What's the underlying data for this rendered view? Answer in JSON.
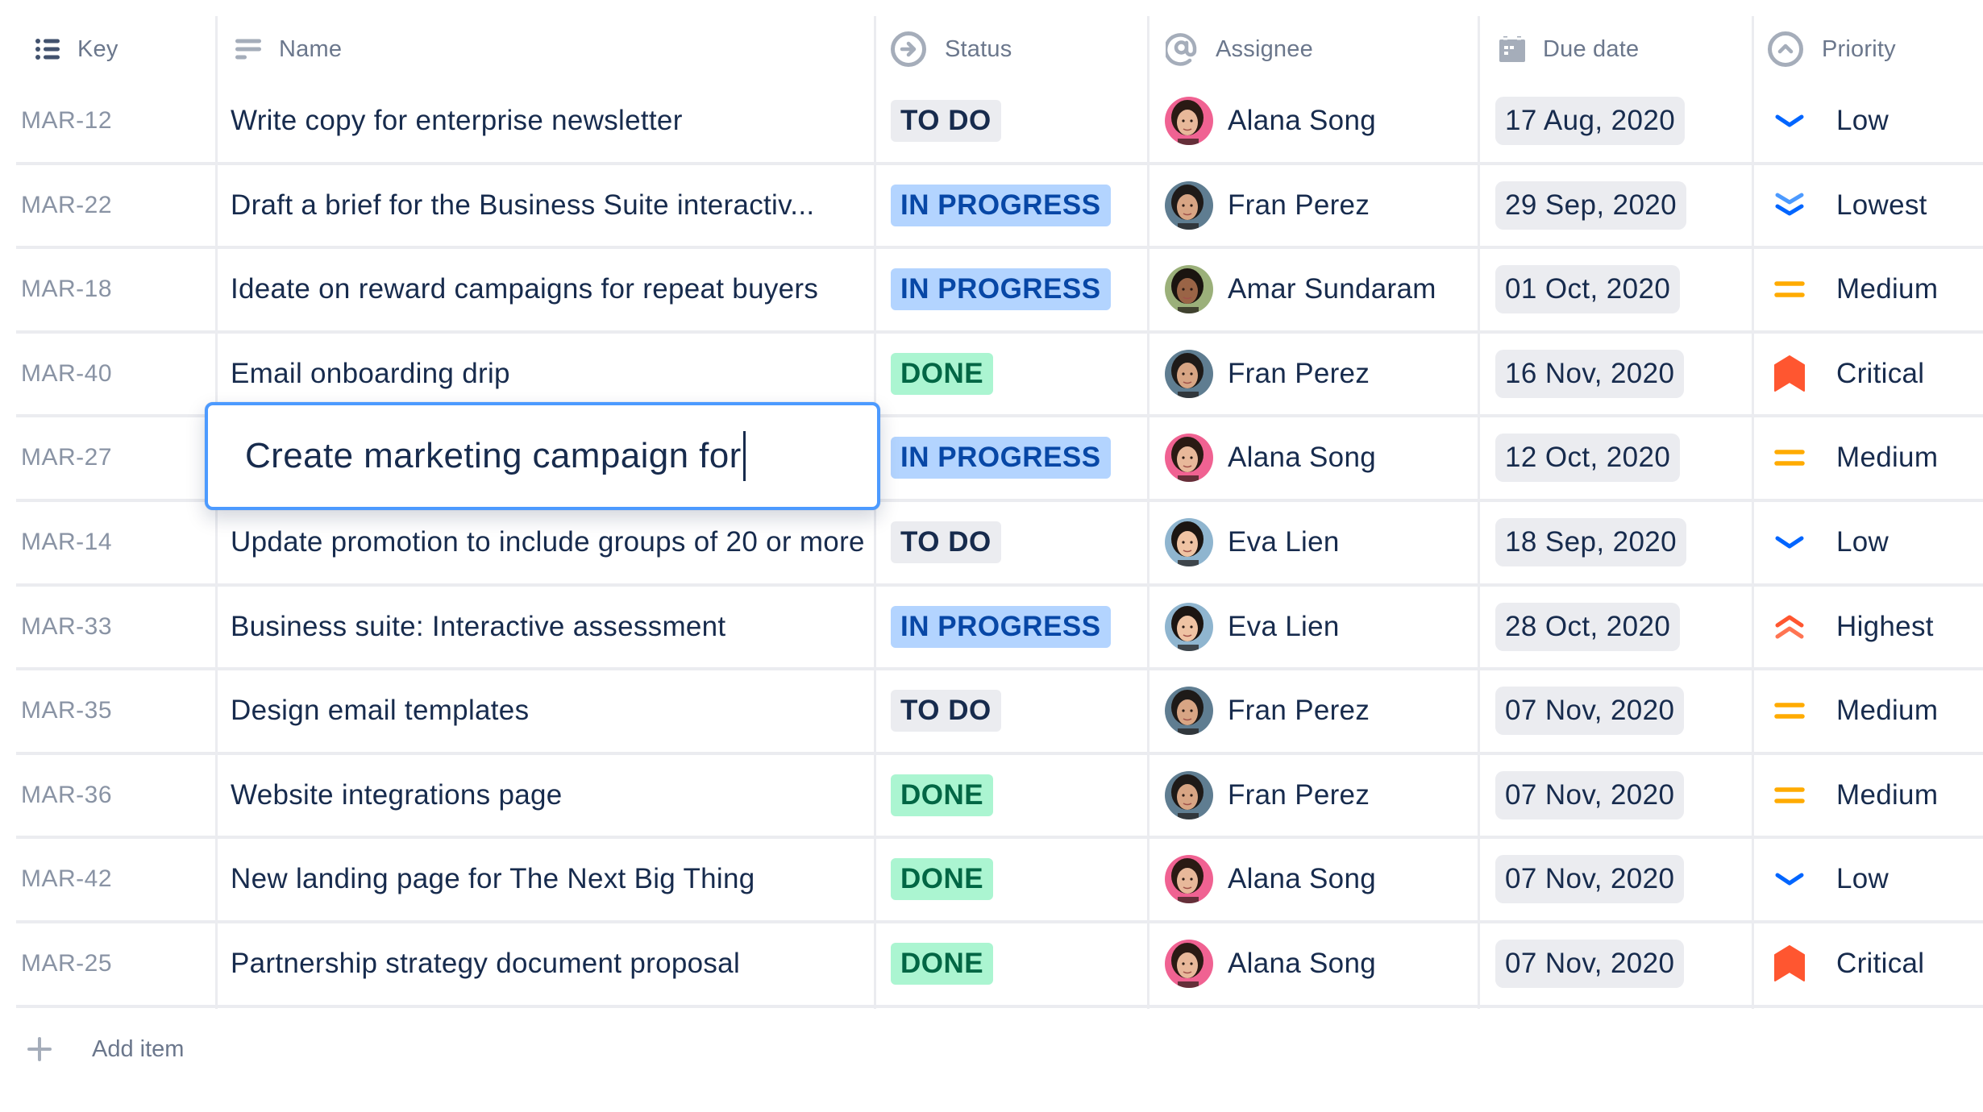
{
  "columns": {
    "key": {
      "label": "Key",
      "icon": "list-bullet-icon"
    },
    "name": {
      "label": "Name",
      "icon": "text-lines-icon"
    },
    "status": {
      "label": "Status",
      "icon": "arrow-circle-right-icon"
    },
    "assignee": {
      "label": "Assignee",
      "icon": "at-sign-icon"
    },
    "due_date": {
      "label": "Due date",
      "icon": "calendar-icon"
    },
    "priority": {
      "label": "Priority",
      "icon": "chevron-circle-up-icon"
    }
  },
  "status_colors": {
    "TO DO": {
      "bg": "#ebecf0",
      "fg": "#172b4d"
    },
    "IN PROGRESS": {
      "bg": "#b3d4ff",
      "fg": "#0747a6"
    },
    "DONE": {
      "bg": "#abf5d1",
      "fg": "#006644"
    }
  },
  "priority_colors": {
    "Lowest": "#0065ff",
    "Low": "#0065ff",
    "Medium": "#ffab00",
    "Highest": "#ff5630",
    "Critical": "#ff5630"
  },
  "rows": [
    {
      "key": "MAR-12",
      "name": "Write copy for enterprise newsletter",
      "status": "TO DO",
      "assignee": "Alana Song",
      "due_date": "17 Aug, 2020",
      "priority": "Low"
    },
    {
      "key": "MAR-22",
      "name": "Draft a brief for the Business Suite interactiv...",
      "status": "IN PROGRESS",
      "assignee": "Fran Perez",
      "due_date": "29 Sep, 2020",
      "priority": "Lowest"
    },
    {
      "key": "MAR-18",
      "name": "Ideate on reward campaigns for repeat buyers",
      "status": "IN PROGRESS",
      "assignee": "Amar Sundaram",
      "due_date": "01 Oct, 2020",
      "priority": "Medium"
    },
    {
      "key": "MAR-40",
      "name": "Email onboarding drip",
      "status": "DONE",
      "assignee": "Fran Perez",
      "due_date": "16 Nov, 2020",
      "priority": "Critical"
    },
    {
      "key": "MAR-27",
      "name": "",
      "status": "IN PROGRESS",
      "assignee": "Alana Song",
      "due_date": "12 Oct, 2020",
      "priority": "Medium"
    },
    {
      "key": "MAR-14",
      "name": "Update promotion to include groups of 20 or more",
      "status": "TO DO",
      "assignee": "Eva Lien",
      "due_date": "18 Sep, 2020",
      "priority": "Low"
    },
    {
      "key": "MAR-33",
      "name": "Business suite: Interactive assessment",
      "status": "IN PROGRESS",
      "assignee": "Eva Lien",
      "due_date": "28 Oct, 2020",
      "priority": "Highest"
    },
    {
      "key": "MAR-35",
      "name": "Design email templates",
      "status": "TO DO",
      "assignee": "Fran Perez",
      "due_date": "07 Nov, 2020",
      "priority": "Medium"
    },
    {
      "key": "MAR-36",
      "name": "Website integrations page",
      "status": "DONE",
      "assignee": "Fran Perez",
      "due_date": "07 Nov, 2020",
      "priority": "Medium"
    },
    {
      "key": "MAR-42",
      "name": "New landing page for The Next Big Thing",
      "status": "DONE",
      "assignee": "Alana Song",
      "due_date": "07 Nov, 2020",
      "priority": "Low"
    },
    {
      "key": "MAR-25",
      "name": "Partnership strategy document proposal",
      "status": "DONE",
      "assignee": "Alana Song",
      "due_date": "07 Nov, 2020",
      "priority": "Critical"
    }
  ],
  "editor": {
    "row_key": "MAR-27",
    "value": "Create marketing campaign for"
  },
  "avatars": {
    "Alana Song": {
      "skin": "#e8b89a",
      "hair": "#2a1a14",
      "bg": "#f06292"
    },
    "Fran Perez": {
      "skin": "#d8a584",
      "hair": "#1e1a18",
      "bg": "#5f7d91"
    },
    "Amar Sundaram": {
      "skin": "#9a6446",
      "hair": "#1a1410",
      "bg": "#9bb07a"
    },
    "Eva Lien": {
      "skin": "#efc3a3",
      "hair": "#1b1512",
      "bg": "#8fb5cf"
    }
  },
  "add_item": {
    "label": "Add item",
    "icon": "plus-icon"
  }
}
